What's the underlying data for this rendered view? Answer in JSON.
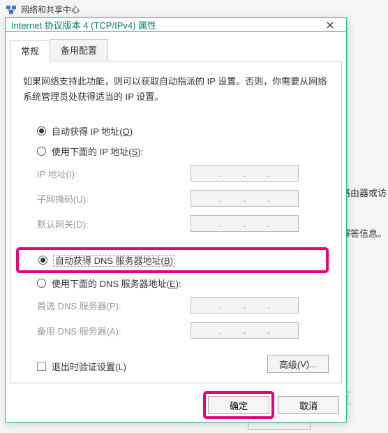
{
  "background": {
    "header_text": "网络和共享中心",
    "side_text_1": "置路由器或访",
    "side_text_2": "解答信息。"
  },
  "dialog": {
    "title": "Internet 协议版本 4 (TCP/IPv4) 属性",
    "tabs": {
      "general": "常规",
      "alt": "备用配置"
    },
    "description": "如果网络支持此功能，则可以获取自动指派的 IP 设置。否则，你需要从网络系统管理员处获得适当的 IP 设置。",
    "ip_group": {
      "auto": {
        "label": "自动获得 IP 地址(",
        "shortcut": "O",
        "tail": ")"
      },
      "manual": {
        "label": "使用下面的 IP 地址(",
        "shortcut": "S",
        "tail": "):"
      },
      "fields": {
        "ip": {
          "label": "IP 地址(",
          "shortcut": "I",
          "tail": "):"
        },
        "mask": {
          "label": "子网掩码(",
          "shortcut": "U",
          "tail": "):"
        },
        "gateway": {
          "label": "默认网关(",
          "shortcut": "D",
          "tail": "):"
        }
      }
    },
    "dns_group": {
      "auto": {
        "label": "自动获得 DNS 服务器地址(",
        "shortcut": "B",
        "tail": ")"
      },
      "manual": {
        "label": "使用下面的 DNS 服务器地址(",
        "shortcut": "E",
        "tail": "):"
      },
      "fields": {
        "preferred": {
          "label": "首选 DNS 服务器(",
          "shortcut": "P",
          "tail": "):"
        },
        "alternate": {
          "label": "备用 DNS 服务器(",
          "shortcut": "A",
          "tail": "):"
        }
      }
    },
    "validate_checkbox": {
      "label": "退出时验证设置(",
      "shortcut": "L",
      "tail": ")"
    },
    "advanced_button": {
      "label": "高级(",
      "shortcut": "V",
      "tail": ")..."
    },
    "ok_button": "确定",
    "cancel_button": "取消"
  }
}
